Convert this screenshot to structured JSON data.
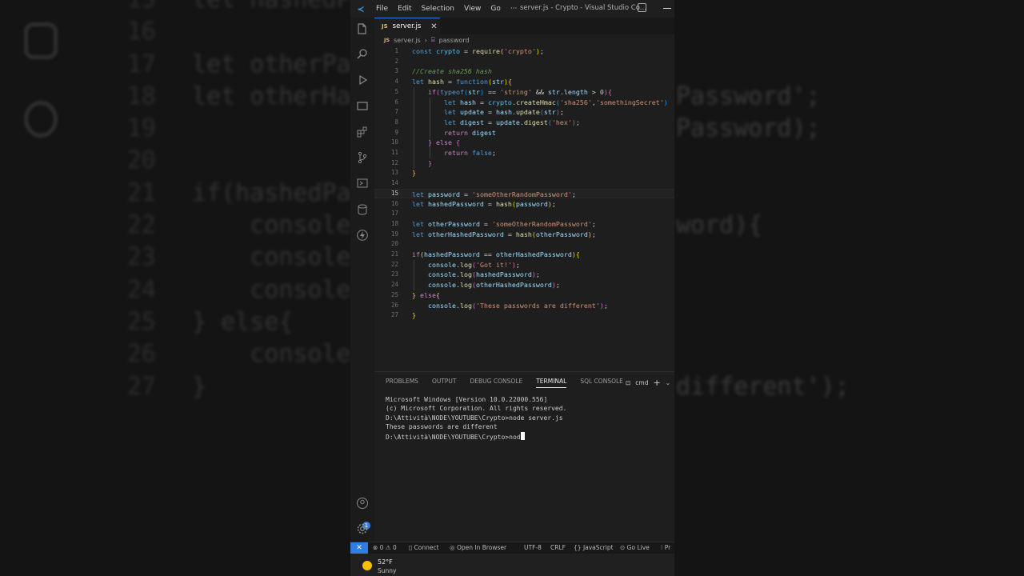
{
  "titlebar": {
    "menu": [
      "File",
      "Edit",
      "Selection",
      "View",
      "Go",
      "···"
    ],
    "title": "server.js - Crypto - Visual Studio Co..."
  },
  "tab": {
    "label": "server.js",
    "lang": "JS"
  },
  "breadcrumb": {
    "file": "server.js",
    "symbol": "password"
  },
  "editor": {
    "current_line": 15,
    "lines": [
      {
        "n": "1"
      },
      {
        "n": "2"
      },
      {
        "n": "3"
      },
      {
        "n": "4"
      },
      {
        "n": "5"
      },
      {
        "n": "6"
      },
      {
        "n": "7"
      },
      {
        "n": "8"
      },
      {
        "n": "9"
      },
      {
        "n": "10"
      },
      {
        "n": "11"
      },
      {
        "n": "12"
      },
      {
        "n": "13"
      },
      {
        "n": "14"
      },
      {
        "n": "15"
      },
      {
        "n": "16"
      },
      {
        "n": "17"
      },
      {
        "n": "18"
      },
      {
        "n": "19"
      },
      {
        "n": "20"
      },
      {
        "n": "21"
      },
      {
        "n": "22"
      },
      {
        "n": "23"
      },
      {
        "n": "24"
      },
      {
        "n": "25"
      },
      {
        "n": "26"
      },
      {
        "n": "27"
      }
    ],
    "code": {
      "l1": {
        "a": "const",
        "b": "crypto",
        "c": "require",
        "d": "'crypto'"
      },
      "l3": "//Create sha256 hash",
      "l4": {
        "a": "let",
        "b": "hash",
        "c": "function",
        "d": "str"
      },
      "l5": {
        "a": "if",
        "b": "typeof",
        "c": "str",
        "d": "'string'",
        "e": "str",
        "f": "length",
        "g": "0"
      },
      "l6": {
        "a": "let",
        "b": "hash",
        "c": "crypto",
        "d": "createHmac",
        "e": "'sha256'",
        "f": "'somethingSecret'"
      },
      "l7": {
        "a": "let",
        "b": "update",
        "c": "hash",
        "d": "update",
        "e": "str"
      },
      "l8": {
        "a": "let",
        "b": "digest",
        "c": "update",
        "d": "digest",
        "e": "'hex'"
      },
      "l9": {
        "a": "return",
        "b": "digest"
      },
      "l10": {
        "a": "else"
      },
      "l11": {
        "a": "return",
        "b": "false"
      },
      "l15": {
        "a": "let",
        "b": "password",
        "c": "'someOtherRandomPassword'"
      },
      "l16": {
        "a": "let",
        "b": "hashedPassword",
        "c": "hash",
        "d": "password"
      },
      "l18": {
        "a": "let",
        "b": "otherPassword",
        "c": "'someOtherRandomPassword'"
      },
      "l19": {
        "a": "let",
        "b": "otherHashedPassword",
        "c": "hash",
        "d": "otherPassword"
      },
      "l21": {
        "a": "if",
        "b": "hashedPassword",
        "c": "otherHashedPassword"
      },
      "l22": {
        "a": "console",
        "b": "log",
        "c": "'Got it!'"
      },
      "l23": {
        "a": "console",
        "b": "log",
        "c": "hashedPassword"
      },
      "l24": {
        "a": "console",
        "b": "log",
        "c": "otherHashedPassword"
      },
      "l25": {
        "a": "else"
      },
      "l26": {
        "a": "console",
        "b": "log",
        "c": "'These passwords are different'"
      }
    }
  },
  "panel": {
    "tabs": [
      "PROBLEMS",
      "OUTPUT",
      "DEBUG CONSOLE",
      "TERMINAL",
      "SQL CONSOLE"
    ],
    "active_tab": "TERMINAL",
    "shell": "cmd",
    "terminal_lines": [
      "Microsoft Windows [Version 10.0.22000.556]",
      "(c) Microsoft Corporation. All rights reserved.",
      "",
      "D:\\Attività\\NODE\\YOUTUBE\\Crypto>node server.js",
      "These passwords are different",
      "",
      "D:\\Attività\\NODE\\YOUTUBE\\Crypto>nod"
    ]
  },
  "statusbar": {
    "errors": "0",
    "warnings": "0",
    "connect": "Connect",
    "open_browser": "Open In Browser",
    "encoding": "UTF-8",
    "eol": "CRLF",
    "language": "JavaScript",
    "go_live": "Go Live",
    "pr": "Pr"
  },
  "taskbar": {
    "temp": "52°F",
    "weather": "Sunny"
  },
  "background": {
    "numbers": [
      "15",
      "16",
      "17",
      "18",
      "19",
      "20",
      "21",
      "22",
      "23",
      "24",
      "25",
      "26",
      "27"
    ],
    "code_left": [
      "let hashedPa",
      "",
      "let otherPa",
      "let otherHa",
      "",
      "",
      "if(hashedPas",
      "    console.",
      "    console.",
      "    console.",
      "} else{",
      "    console.",
      "}"
    ],
    "code_right": [
      "",
      "",
      "",
      "Password';",
      "Password);",
      "",
      "",
      "word){",
      "",
      "",
      "",
      "",
      "different');"
    ]
  }
}
